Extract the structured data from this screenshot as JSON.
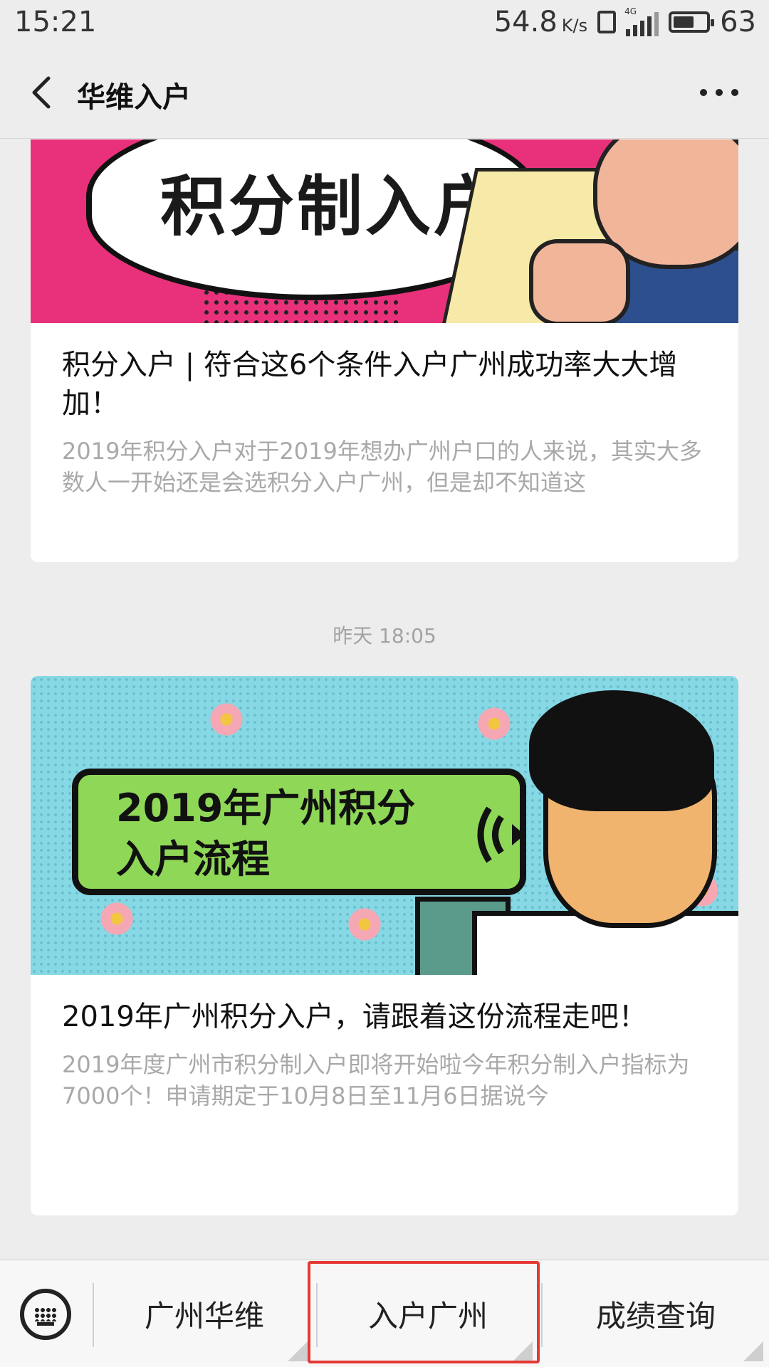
{
  "status_bar": {
    "time": "15:21",
    "speed_value": "54.8",
    "speed_unit": "K/s",
    "network": "4G",
    "battery": "63",
    "battery_level": 0.63
  },
  "header": {
    "title": "华维入户"
  },
  "articles": [
    {
      "cover_text": "积分制入户",
      "title": "积分入户 | 符合这6个条件入户广州成功率大大增加！",
      "summary": "2019年积分入户对于2019年想办广州户口的人来说，其实大多数人一开始还是会选积分入户广州，但是却不知道这"
    },
    {
      "cover_text_line1": "2019年广州积分",
      "cover_text_line2": "入户流程",
      "title": "2019年广州积分入户，请跟着这份流程走吧！",
      "summary": "2019年度广州市积分制入户即将开始啦今年积分制入户指标为7000个！申请期定于10月8日至11月6日据说今"
    }
  ],
  "timestamp": "昨天 18:05",
  "bottom_menu": {
    "items": [
      "广州华维",
      "入户广州",
      "成绩查询"
    ],
    "highlight_color": "#e53935"
  }
}
